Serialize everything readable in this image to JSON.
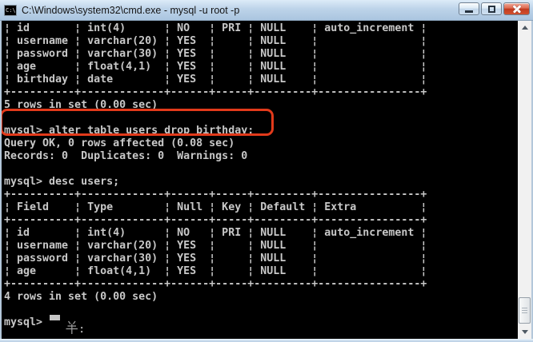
{
  "window": {
    "title": "C:\\Windows\\system32\\cmd.exe - mysql  -u root -p",
    "icon_label": "C:\\",
    "icons": {
      "app": "cmd-icon",
      "minimize": "minimize-icon",
      "maximize": "maximize-icon",
      "close": "close-icon"
    }
  },
  "console": {
    "background": "#000000",
    "text_color": "#c8c8c8",
    "lines": [
      "¦ id       ¦ int(4)      ¦ NO   ¦ PRI ¦ NULL    ¦ auto_increment ¦",
      "¦ username ¦ varchar(20) ¦ YES  ¦     ¦ NULL    ¦                ¦",
      "¦ password ¦ varchar(30) ¦ YES  ¦     ¦ NULL    ¦                ¦",
      "¦ age      ¦ float(4,1)  ¦ YES  ¦     ¦ NULL    ¦                ¦",
      "¦ birthday ¦ date        ¦ YES  ¦     ¦ NULL    ¦                ¦",
      "+----------+-------------+------+-----+---------+----------------+",
      "5 rows in set (0.00 sec)",
      "",
      "mysql> alter table users drop birthday;",
      "Query OK, 0 rows affected (0.08 sec)",
      "Records: 0  Duplicates: 0  Warnings: 0",
      "",
      "mysql> desc users;",
      "+----------+-------------+------+-----+---------+----------------+",
      "¦ Field    ¦ Type        ¦ Null ¦ Key ¦ Default ¦ Extra          ¦",
      "+----------+-------------+------+-----+---------+----------------+",
      "¦ id       ¦ int(4)      ¦ NO   ¦ PRI ¦ NULL    ¦ auto_increment ¦",
      "¦ username ¦ varchar(20) ¦ YES  ¦     ¦ NULL    ¦                ¦",
      "¦ password ¦ varchar(30) ¦ YES  ¦     ¦ NULL    ¦                ¦",
      "¦ age      ¦ float(4,1)  ¦ YES  ¦     ¦ NULL    ¦                ¦",
      "+----------+-------------+------+-----+---------+----------------+",
      "4 rows in set (0.00 sec)",
      "",
      "mysql>"
    ],
    "ime_indicator": "半:"
  },
  "annotation": {
    "type": "highlight-box",
    "color": "#e23a1b",
    "highlighted_text": "mysql> alter table users drop birthday;"
  },
  "scrollbar": {
    "orientation": "vertical",
    "thumb_position": "near-bottom"
  }
}
